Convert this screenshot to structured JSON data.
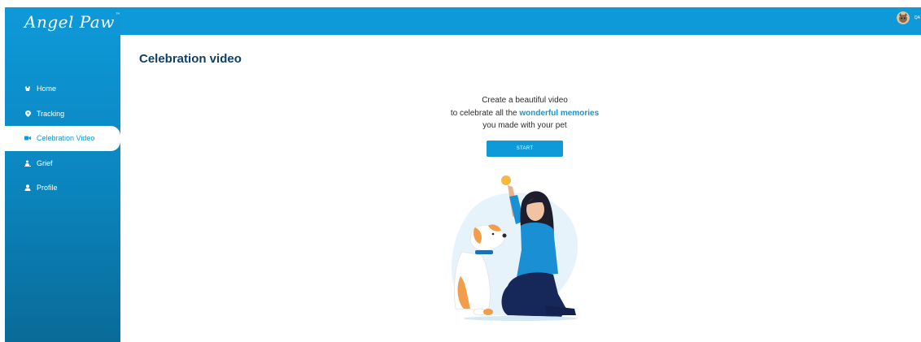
{
  "app": {
    "logo_text": "Angel Paw",
    "logo_mark": "™"
  },
  "header": {
    "user_label": "QA"
  },
  "sidebar": {
    "items": [
      {
        "label": "Home",
        "icon": "dog-icon"
      },
      {
        "label": "Tracking",
        "icon": "location-pin-icon"
      },
      {
        "label": "Celebration Video",
        "icon": "video-camera-icon",
        "active": true
      },
      {
        "label": "Grief",
        "icon": "grief-icon"
      },
      {
        "label": "Profile",
        "icon": "user-icon"
      }
    ]
  },
  "main": {
    "title": "Celebration video",
    "line1": "Create a beautiful video",
    "line2_prefix": "to celebrate all the ",
    "line2_highlight": "wonderful memories",
    "line3": "you made with your pet",
    "start_label": "START"
  },
  "colors": {
    "primary": "#0e99d9",
    "title": "#0f3f64",
    "sidebar_bottom": "#096b98"
  }
}
